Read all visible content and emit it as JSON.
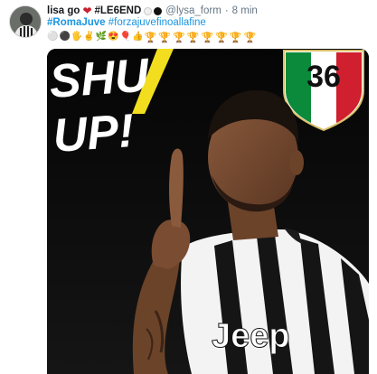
{
  "tweet": {
    "display_name": "lisa go",
    "legend_tag": "#LE6END",
    "handle": "@lysa_form",
    "separator": "·",
    "time": "8 min",
    "hashtag_main": "#RomaJuve",
    "hashtag_second": "#forzajuvefinoallafine",
    "emoji_row": [
      "⚪",
      "⚫",
      "🖐",
      "✌",
      "🌿",
      "😍",
      "🎈",
      "👍"
    ],
    "trophy_count": 8
  },
  "media": {
    "shut_text": "SHU",
    "up_text": "UP!",
    "badge_number": "36",
    "sponsor_text": "Jeep",
    "alt": "photo"
  },
  "colors": {
    "link": "#1b95e0",
    "heart": "#c9202f",
    "accent_yellow": "#f2de1e",
    "italy_green": "#0b8a3b",
    "italy_red": "#d01f2e"
  }
}
